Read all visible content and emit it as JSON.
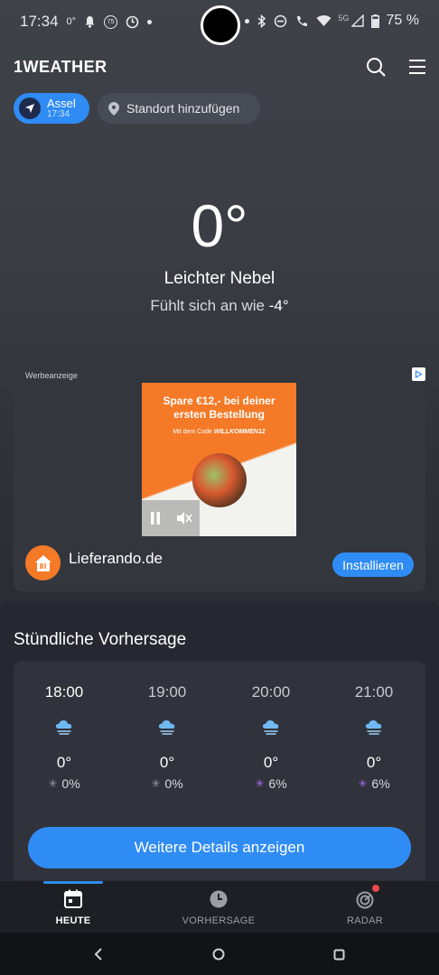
{
  "status_bar": {
    "time": "17:34",
    "temp": "0°",
    "badge": "75",
    "network": "5G",
    "battery": "75 %"
  },
  "app": {
    "logo": "1WEATHER"
  },
  "location": {
    "active_name": "Assel",
    "active_time": "17:34",
    "add_label": "Standort hinzufügen"
  },
  "current": {
    "temperature": "0°",
    "condition": "Leichter Nebel",
    "feels_prefix": "Fühlt sich an wie",
    "feels_value": "-4°"
  },
  "ad": {
    "label": "Werbeanzeige",
    "headline_1": "Spare €12,- bei deiner",
    "headline_2": "ersten Bestellung",
    "sub_prefix": "Mit dem Code",
    "sub_code": "WILLKOMMEN12",
    "brand": "Lieferando.de",
    "cta": "Installieren"
  },
  "hourly": {
    "title": "Stündliche Vorhersage",
    "items": [
      {
        "time": "18:00",
        "temp": "0°",
        "precip": "0%",
        "icon": "fog-cloud-icon",
        "precip_color": "#9a9da3"
      },
      {
        "time": "19:00",
        "temp": "0°",
        "precip": "0%",
        "icon": "fog-cloud-icon",
        "precip_color": "#9a9da3"
      },
      {
        "time": "20:00",
        "temp": "0°",
        "precip": "6%",
        "icon": "fog-cloud-icon",
        "precip_color": "#a86cf0"
      },
      {
        "time": "21:00",
        "temp": "0°",
        "precip": "6%",
        "icon": "fog-cloud-icon",
        "precip_color": "#a86cf0"
      }
    ],
    "details_button": "Weitere Details anzeigen"
  },
  "nav": {
    "items": [
      {
        "label": "HEUTE",
        "icon": "calendar-icon",
        "active": true
      },
      {
        "label": "VORHERSAGE",
        "icon": "clock-icon",
        "active": false
      },
      {
        "label": "RADAR",
        "icon": "radar-icon",
        "active": false
      }
    ]
  },
  "colors": {
    "accent": "#2f8cf4",
    "brand_orange": "#f47a28"
  }
}
